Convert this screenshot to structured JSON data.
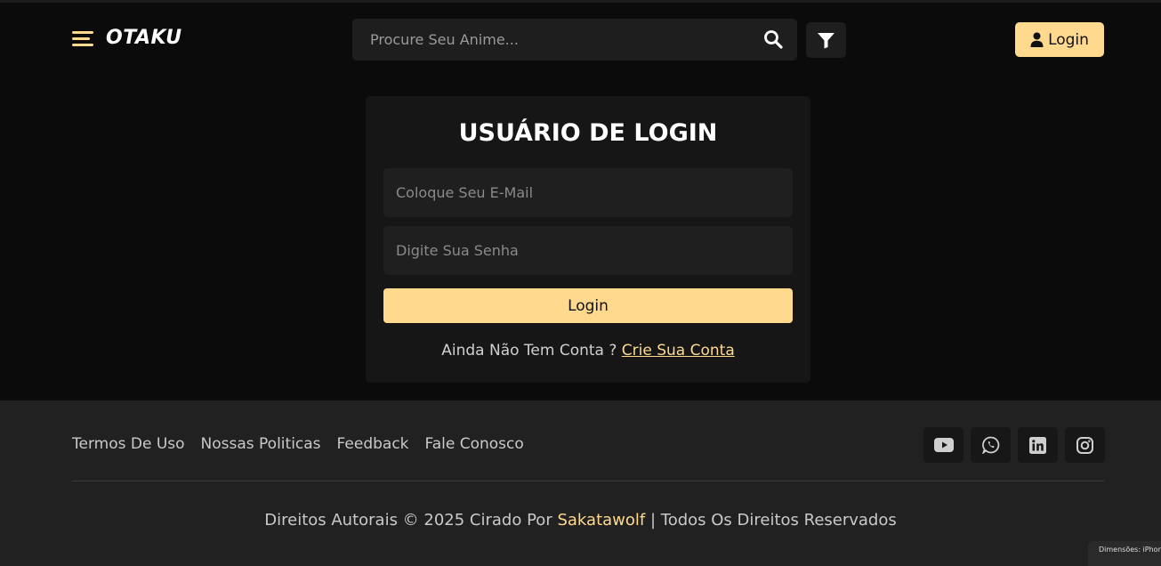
{
  "header": {
    "logo": "OTAKU",
    "search": {
      "placeholder": "Procure Seu Anime..."
    },
    "login_label": "Login"
  },
  "login_card": {
    "title": "USUÁRIO DE LOGIN",
    "email_placeholder": "Coloque Seu E-Mail",
    "password_placeholder": "Digite Sua Senha",
    "submit_label": "Login",
    "signup_prompt": "Ainda Não Tem Conta ?",
    "signup_link": "Crie Sua Conta"
  },
  "footer": {
    "links": [
      "Termos De Uso",
      "Nossas Politicas",
      "Feedback",
      "Fale Conosco"
    ],
    "socials": [
      "youtube-icon",
      "whatsapp-icon",
      "linkedin-icon",
      "instagram-icon"
    ],
    "copyright_prefix": "Direitos Autorais © 2025 Cirado Por",
    "author": "Sakatawolf",
    "copyright_suffix": "| Todos Os Direitos Reservados"
  },
  "devtools_badge": "Dimensões: iPhone",
  "colors": {
    "accent": "#ffd98e",
    "background": "#0b0b0b",
    "card": "#161616",
    "footer": "#212121"
  }
}
